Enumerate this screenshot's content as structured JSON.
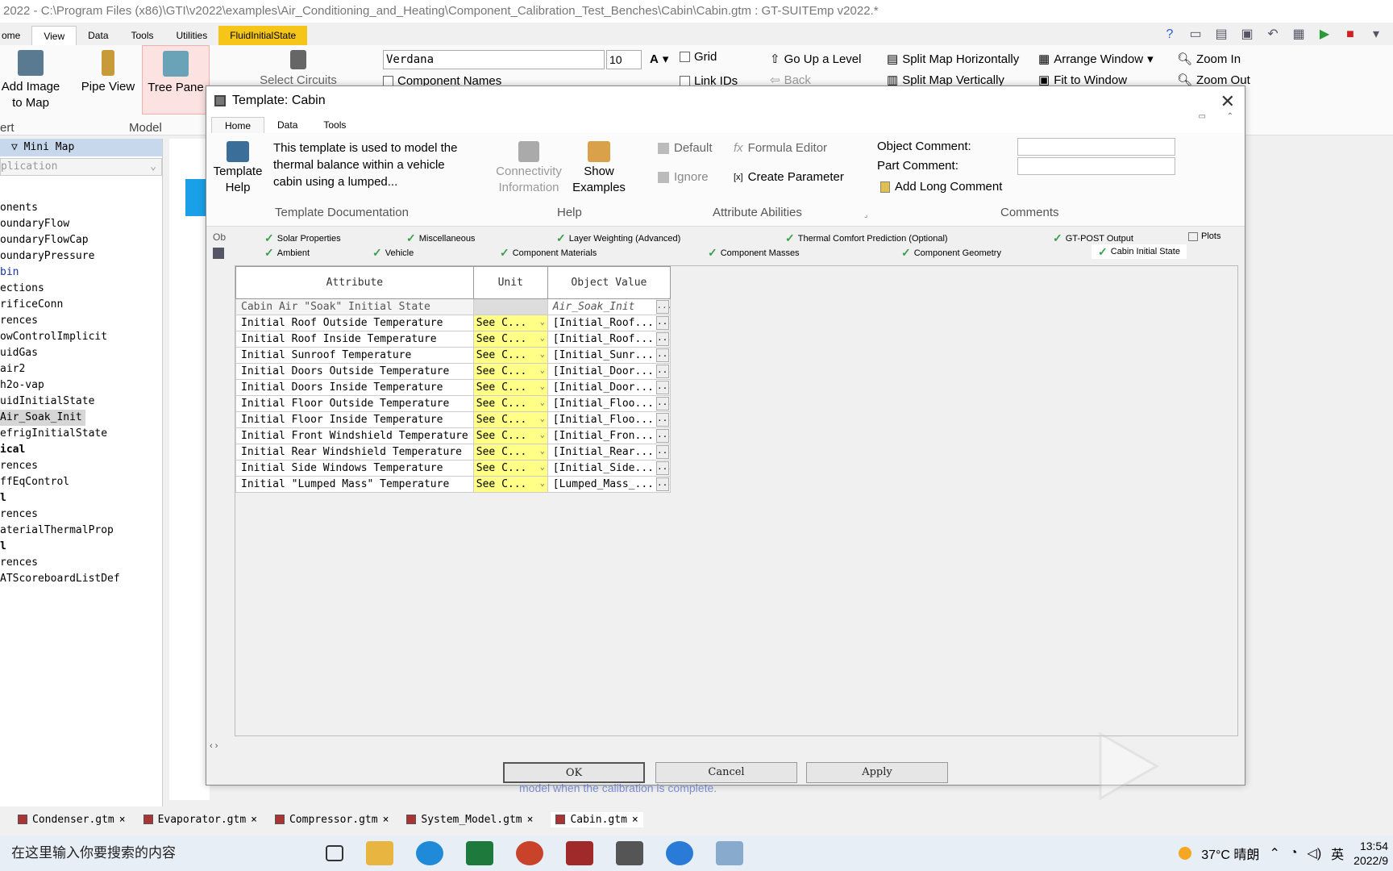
{
  "window": {
    "title": "2022 - C:\\Program Files (x86)\\GTI\\v2022\\examples\\Air_Conditioning_and_Heating\\Component_Calibration_Test_Benches\\Cabin\\Cabin.gtm : GT-SUITEmp v2022.*"
  },
  "ribbon_tabs": [
    "ome",
    "View",
    "Data",
    "Tools",
    "Utilities",
    "FluidInitialState"
  ],
  "ribbon": {
    "add_image": "Add Image to Map",
    "pipe_view": "Pipe View",
    "tree_pane": "Tree Pane",
    "select_circuits": "Select Circuits",
    "group_insert": "ert",
    "group_model": "Model",
    "font": "Verdana",
    "font_size": "10",
    "grid": "Grid",
    "component_names": "Component Names",
    "link_ids": "Link IDs",
    "go_up_level": "Go Up a Level",
    "back": "Back",
    "split_horiz": "Split Map Horizontally",
    "split_vert": "Split Map Vertically",
    "arrange_window": "Arrange Window",
    "fit_window": "Fit to Window",
    "zoom_in": "Zoom In",
    "zoom_out": "Zoom Out"
  },
  "left_pane": {
    "minimap": "Mini Map",
    "app_select": "plication",
    "items": [
      {
        "label": "onents",
        "style": ""
      },
      {
        "label": "oundaryFlow",
        "style": ""
      },
      {
        "label": "oundaryFlowCap",
        "style": ""
      },
      {
        "label": "oundaryPressure",
        "style": ""
      },
      {
        "label": "bin",
        "style": "blue"
      },
      {
        "label": "ections",
        "style": ""
      },
      {
        "label": "rificeConn",
        "style": ""
      },
      {
        "label": "rences",
        "style": ""
      },
      {
        "label": "owControlImplicit",
        "style": ""
      },
      {
        "label": "uidGas",
        "style": ""
      },
      {
        "label": "air2",
        "style": ""
      },
      {
        "label": "h2o-vap",
        "style": ""
      },
      {
        "label": "uidInitialState",
        "style": ""
      },
      {
        "label": "Air_Soak_Init",
        "style": "sel"
      },
      {
        "label": "efrigInitialState",
        "style": ""
      },
      {
        "label": "ical",
        "style": "bold"
      },
      {
        "label": "rences",
        "style": ""
      },
      {
        "label": "ffEqControl",
        "style": ""
      },
      {
        "label": "l",
        "style": "bold"
      },
      {
        "label": "rences",
        "style": ""
      },
      {
        "label": "aterialThermalProp",
        "style": ""
      },
      {
        "label": "l",
        "style": "bold"
      },
      {
        "label": "rences",
        "style": ""
      },
      {
        "label": "ATScoreboardListDef",
        "style": ""
      }
    ]
  },
  "dialog": {
    "title": "Template: Cabin",
    "tabs": [
      "Home",
      "Data",
      "Tools"
    ],
    "template_help": "Template Help",
    "description": "This template is used to model the thermal balance within a vehicle cabin using a lumped...",
    "grp_doc": "Template Documentation",
    "connectivity": "Connectivity Information",
    "show_examples": "Show Examples",
    "grp_help": "Help",
    "default": "Default",
    "ignore": "Ignore",
    "formula_editor": "Formula Editor",
    "create_parameter": "Create Parameter",
    "grp_attr": "Attribute Abilities",
    "object_comment": "Object Comment:",
    "part_comment": "Part Comment:",
    "add_long_comment": "Add Long Comment",
    "grp_comments": "Comments",
    "ob_label": "Ob",
    "category_tabs_row1": [
      "Solar Properties",
      "Miscellaneous",
      "Layer Weighting (Advanced)",
      "Thermal Comfort Prediction (Optional)",
      "GT-POST Output",
      "Plots"
    ],
    "category_tabs_row2": [
      "Ambient",
      "Vehicle",
      "Component Materials",
      "Component Masses",
      "Component Geometry",
      "Cabin Initial State"
    ],
    "columns": [
      "Attribute",
      "Unit",
      "Object Value"
    ],
    "rows": [
      {
        "attribute": "Cabin Air \"Soak\" Initial State",
        "unit": "",
        "value": "Air_Soak_Init"
      },
      {
        "attribute": "Initial Roof Outside Temperature",
        "unit": "See C...",
        "value": "[Initial_Roof..."
      },
      {
        "attribute": "Initial Roof Inside Temperature",
        "unit": "See C...",
        "value": "[Initial_Roof..."
      },
      {
        "attribute": "Initial Sunroof Temperature",
        "unit": "See C...",
        "value": "[Initial_Sunr..."
      },
      {
        "attribute": "Initial Doors Outside Temperature",
        "unit": "See C...",
        "value": "[Initial_Door..."
      },
      {
        "attribute": "Initial Doors Inside Temperature",
        "unit": "See C...",
        "value": "[Initial_Door..."
      },
      {
        "attribute": "Initial Floor Outside Temperature",
        "unit": "See C...",
        "value": "[Initial_Floo..."
      },
      {
        "attribute": "Initial Floor Inside Temperature",
        "unit": "See C...",
        "value": "[Initial_Floo..."
      },
      {
        "attribute": "Initial Front Windshield Temperature",
        "unit": "See C...",
        "value": "[Initial_Fron..."
      },
      {
        "attribute": "Initial Rear Windshield Temperature",
        "unit": "See C...",
        "value": "[Initial_Rear..."
      },
      {
        "attribute": "Initial Side Windows Temperature",
        "unit": "See C...",
        "value": "[Initial_Side..."
      },
      {
        "attribute": "Initial \"Lumped Mass\" Temperature",
        "unit": "See C...",
        "value": "[Lumped_Mass_..."
      }
    ],
    "ok": "OK",
    "cancel": "Cancel",
    "apply": "Apply",
    "behind_text": "model when the calibration is complete."
  },
  "file_tabs": [
    "Condenser.gtm",
    "Evaporator.gtm",
    "Compressor.gtm",
    "System_Model.gtm",
    "Cabin.gtm"
  ],
  "taskbar": {
    "search": "在这里输入你要搜索的内容",
    "weather": "37°C 晴朗",
    "ime": "英",
    "time": "13:54",
    "date": "2022/9"
  }
}
